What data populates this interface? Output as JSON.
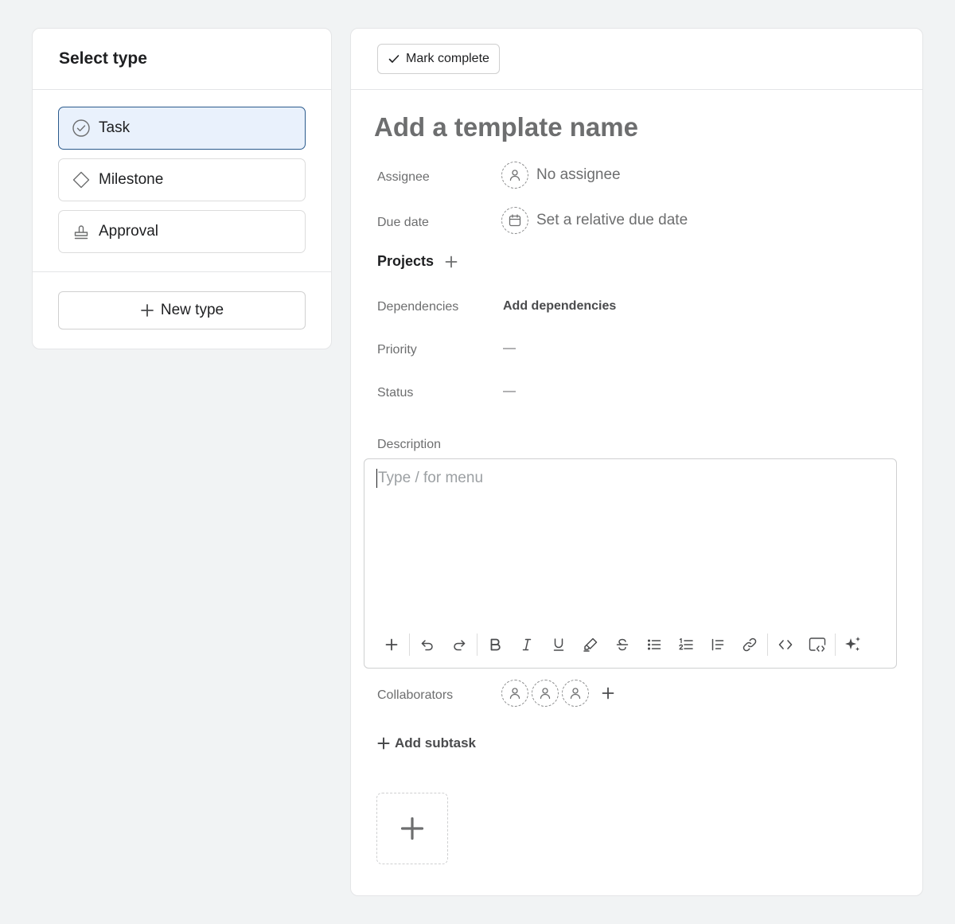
{
  "type_panel": {
    "title": "Select type",
    "options": [
      {
        "label": "Task",
        "icon": "check-circle-icon",
        "selected": true
      },
      {
        "label": "Milestone",
        "icon": "diamond-icon",
        "selected": false
      },
      {
        "label": "Approval",
        "icon": "stamp-icon",
        "selected": false
      }
    ],
    "new_type_label": "New type"
  },
  "task": {
    "mark_complete_label": "Mark complete",
    "name_placeholder": "Add a template name",
    "fields": {
      "assignee": {
        "label": "Assignee",
        "value": "No assignee"
      },
      "due_date": {
        "label": "Due date",
        "value": "Set a relative due date"
      },
      "projects": {
        "label": "Projects"
      },
      "dependencies": {
        "label": "Dependencies",
        "value": "Add dependencies"
      },
      "priority": {
        "label": "Priority",
        "value": "—"
      },
      "status": {
        "label": "Status",
        "value": "—"
      }
    },
    "description": {
      "label": "Description",
      "placeholder": "Type / for menu"
    },
    "collaborators": {
      "label": "Collaborators",
      "count": 3
    },
    "add_subtask_label": "Add subtask"
  },
  "colors": {
    "accent_selected_bg": "#e9f1fc",
    "accent_selected_border": "#2a5a8c",
    "text_muted": "#6d6e6f",
    "page_bg": "#f1f3f4"
  }
}
